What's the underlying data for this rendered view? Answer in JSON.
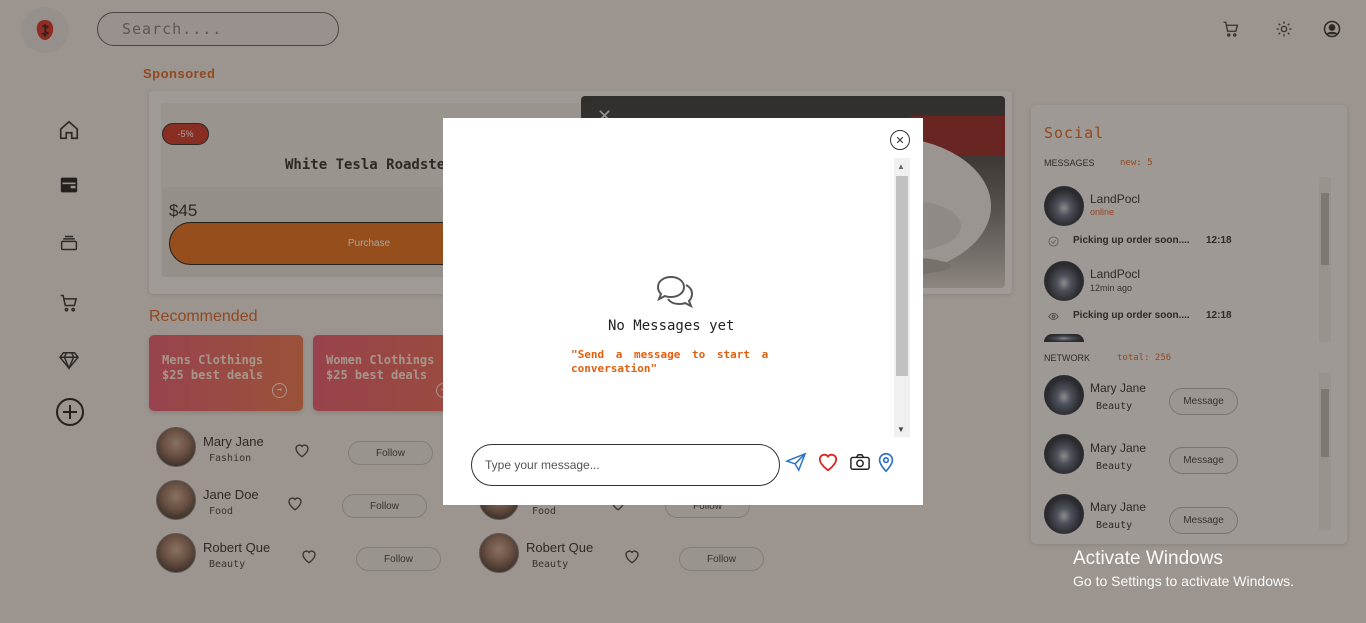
{
  "header": {
    "search_placeholder": "Search...."
  },
  "sponsored": {
    "label": "Sponsored",
    "discount": "-5%",
    "title": "White Tesla Roadster",
    "price": "$45",
    "purchase_label": "Purchase"
  },
  "recommended": {
    "title": "Recommended",
    "deals": [
      {
        "line1": "Mens Clothings",
        "line2": "$25 best deals"
      },
      {
        "line1": "Women Clothings",
        "line2": "$25 best deals"
      }
    ],
    "people_left": [
      {
        "name": "Mary Jane",
        "category": "Fashion",
        "follow": "Follow"
      },
      {
        "name": "Jane Doe",
        "category": "Food",
        "follow": "Follow"
      },
      {
        "name": "Robert Que",
        "category": "Beauty",
        "follow": "Follow"
      }
    ],
    "people_right": [
      {
        "name": "",
        "category": "Food",
        "follow": "Follow"
      },
      {
        "name": "Robert Que",
        "category": "Beauty",
        "follow": "Follow"
      }
    ]
  },
  "social": {
    "title": "Social",
    "messages_label": "MESSAGES",
    "messages_meta": "new: 5",
    "messages": [
      {
        "name": "LandPocl",
        "status": "online",
        "preview": "Picking up order soon....",
        "time": "12:18"
      },
      {
        "name": "LandPocl",
        "status": "12min ago",
        "preview": "Picking up order soon....",
        "time": "12:18"
      }
    ],
    "network_label": "NETWORK",
    "network_meta": "total: 256",
    "network": [
      {
        "name": "Mary Jane",
        "category": "Beauty",
        "button": "Message"
      },
      {
        "name": "Mary Jane",
        "category": "Beauty",
        "button": "Message"
      },
      {
        "name": "Mary Jane",
        "category": "Beauty",
        "button": "Message"
      }
    ]
  },
  "watermark": {
    "line1": "Activate Windows",
    "line2": "Go to Settings to activate Windows."
  },
  "modal": {
    "empty_title": "No Messages yet",
    "empty_subtitle": "\"Send a message to start a conversation\"",
    "input_placeholder": "Type your message..."
  },
  "colors": {
    "accent": "#d85a14",
    "purchase": "#e06710",
    "discount": "#c62a1c"
  }
}
